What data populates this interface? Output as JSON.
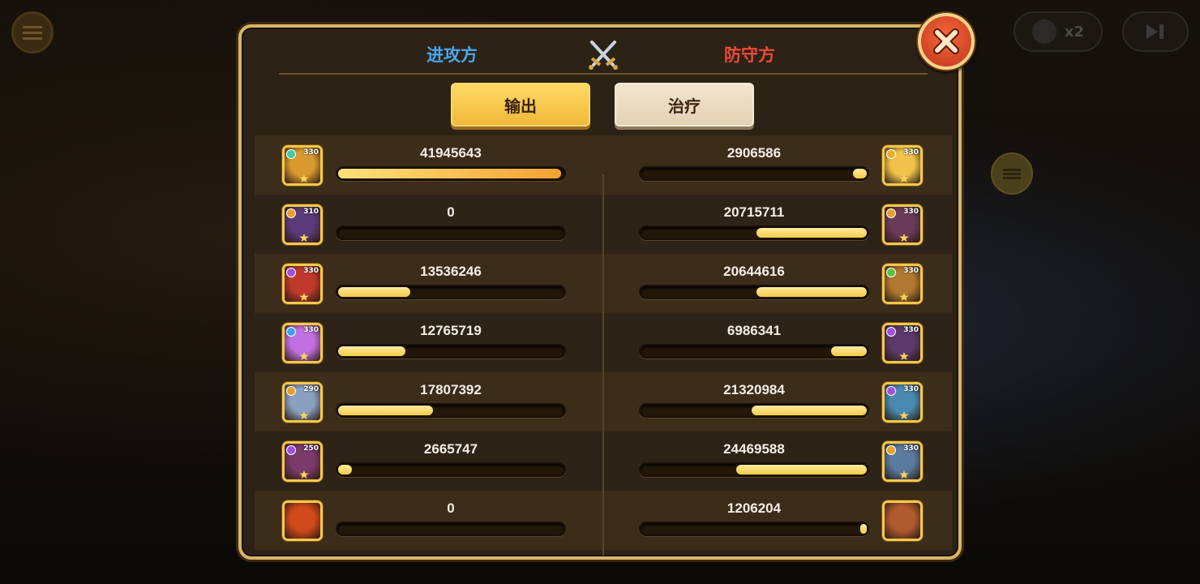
{
  "header": {
    "attacker_label": "进攻方",
    "defender_label": "防守方"
  },
  "tabs": {
    "output_label": "输出",
    "healing_label": "治疗",
    "active": "output"
  },
  "hud": {
    "speed_label": "x2"
  },
  "colors": {
    "attacker": "#4aa8f0",
    "defender": "#ee4a3a",
    "bar_fill": "#f4cd48",
    "panel_border": "#d9b469"
  },
  "rows": [
    {
      "left": {
        "value": "41945643",
        "fraction": 0.99,
        "level": "330",
        "element": "#3fc9a8",
        "face": "#d89a2e"
      },
      "right": {
        "value": "2906586",
        "fraction": 0.06,
        "level": "330",
        "element": "#e8b030",
        "face": "#f0c24a"
      }
    },
    {
      "left": {
        "value": "0",
        "fraction": 0.0,
        "level": "310",
        "element": "#e8a030",
        "face": "#5b3a7a"
      },
      "right": {
        "value": "20715711",
        "fraction": 0.49,
        "level": "330",
        "element": "#e8a030",
        "face": "#6a3a5a"
      }
    },
    {
      "left": {
        "value": "13536246",
        "fraction": 0.32,
        "level": "330",
        "element": "#a050e0",
        "face": "#c0392b"
      },
      "right": {
        "value": "20644616",
        "fraction": 0.49,
        "level": "330",
        "element": "#60c040",
        "face": "#b07830"
      }
    },
    {
      "left": {
        "value": "12765719",
        "fraction": 0.3,
        "level": "330",
        "element": "#3fa0f0",
        "face": "#c070e0"
      },
      "right": {
        "value": "6986341",
        "fraction": 0.16,
        "level": "330",
        "element": "#a050e0",
        "face": "#5a3a6a"
      }
    },
    {
      "left": {
        "value": "17807392",
        "fraction": 0.42,
        "level": "290",
        "element": "#e8a030",
        "face": "#8aa0c0"
      },
      "right": {
        "value": "21320984",
        "fraction": 0.51,
        "level": "330",
        "element": "#a050e0",
        "face": "#4a8ab0"
      }
    },
    {
      "left": {
        "value": "2665747",
        "fraction": 0.06,
        "level": "250",
        "element": "#a050e0",
        "face": "#7a3a6a"
      },
      "right": {
        "value": "24469588",
        "fraction": 0.58,
        "level": "330",
        "element": "#e8a030",
        "face": "#5a7aa0"
      }
    },
    {
      "left": {
        "value": "0",
        "fraction": 0.0,
        "level": "",
        "element": "",
        "face": "#d04a1a"
      },
      "right": {
        "value": "1206204",
        "fraction": 0.03,
        "level": "",
        "element": "",
        "face": "#b05a30"
      }
    }
  ]
}
